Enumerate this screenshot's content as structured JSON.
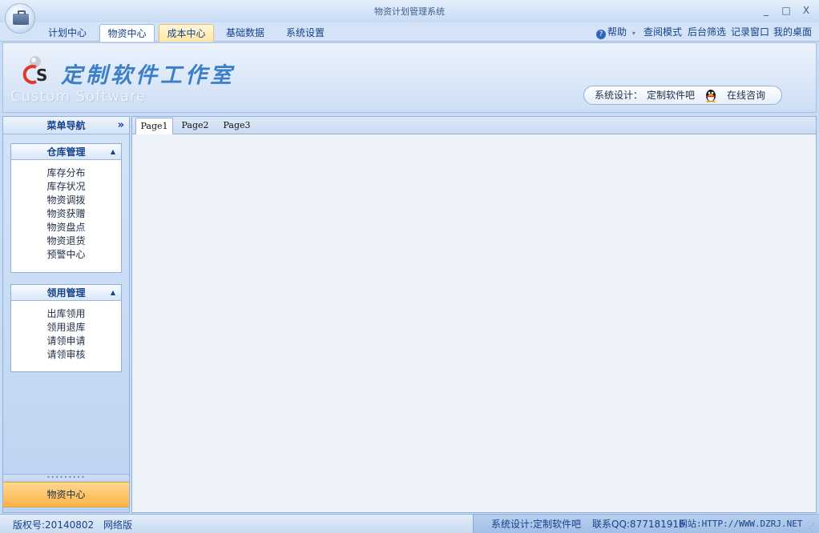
{
  "window": {
    "title": "物资计划管理系统",
    "minimize": "_",
    "maximize": "□",
    "close": "X"
  },
  "menu": {
    "tabs": [
      "计划中心",
      "物资中心",
      "成本中心",
      "基础数据",
      "系统设置"
    ],
    "active_tab": "物资中心",
    "right_items": {
      "help": "帮助",
      "help_arrow": "▾",
      "read_mode": "查阅模式",
      "backend_filter": "后台筛选",
      "log_window": "记录窗口",
      "my_desktop": "我的桌面"
    }
  },
  "banner": {
    "logo_script": "定制软件工作室",
    "logo_sub": "Custom Software",
    "designer_label": "系统设计：",
    "designer_name": "定制软件吧",
    "consult": "在线咨询"
  },
  "sidebar": {
    "header": "菜单导航",
    "collapse_glyph": "»",
    "groups": [
      {
        "title": "仓库管理",
        "items": [
          "库存分布",
          "库存状况",
          "物资调拨",
          "物资获赠",
          "物资盘点",
          "物资退货",
          "预警中心"
        ]
      },
      {
        "title": "领用管理",
        "items": [
          "出库领用",
          "领用退库",
          "请领申请",
          "请领审核"
        ]
      }
    ],
    "grip": "∙∙∙∙∙∙∙∙∙",
    "active_module": "物资中心"
  },
  "content": {
    "page_tabs": [
      "Page1",
      "Page2",
      "Page3"
    ],
    "active_page": "Page1"
  },
  "statusbar": {
    "version_label": "版权号:20140802",
    "edition": "网络版",
    "design": "系统设计:定制软件吧",
    "contact": "联系QQ:877181916",
    "website": "网站:HTTP://WWW.DZRJ.NET"
  },
  "colors": {
    "accent": "#15428b",
    "active_module_bg": "#fbb347",
    "hover_tab_bg": "#ffe7a2",
    "panel_bg": "#eef3fa"
  },
  "icons": {
    "app": "briefcase-icon",
    "help": "help-icon",
    "qq": "qq-penguin-icon",
    "logo": "cs-logo-icon"
  }
}
